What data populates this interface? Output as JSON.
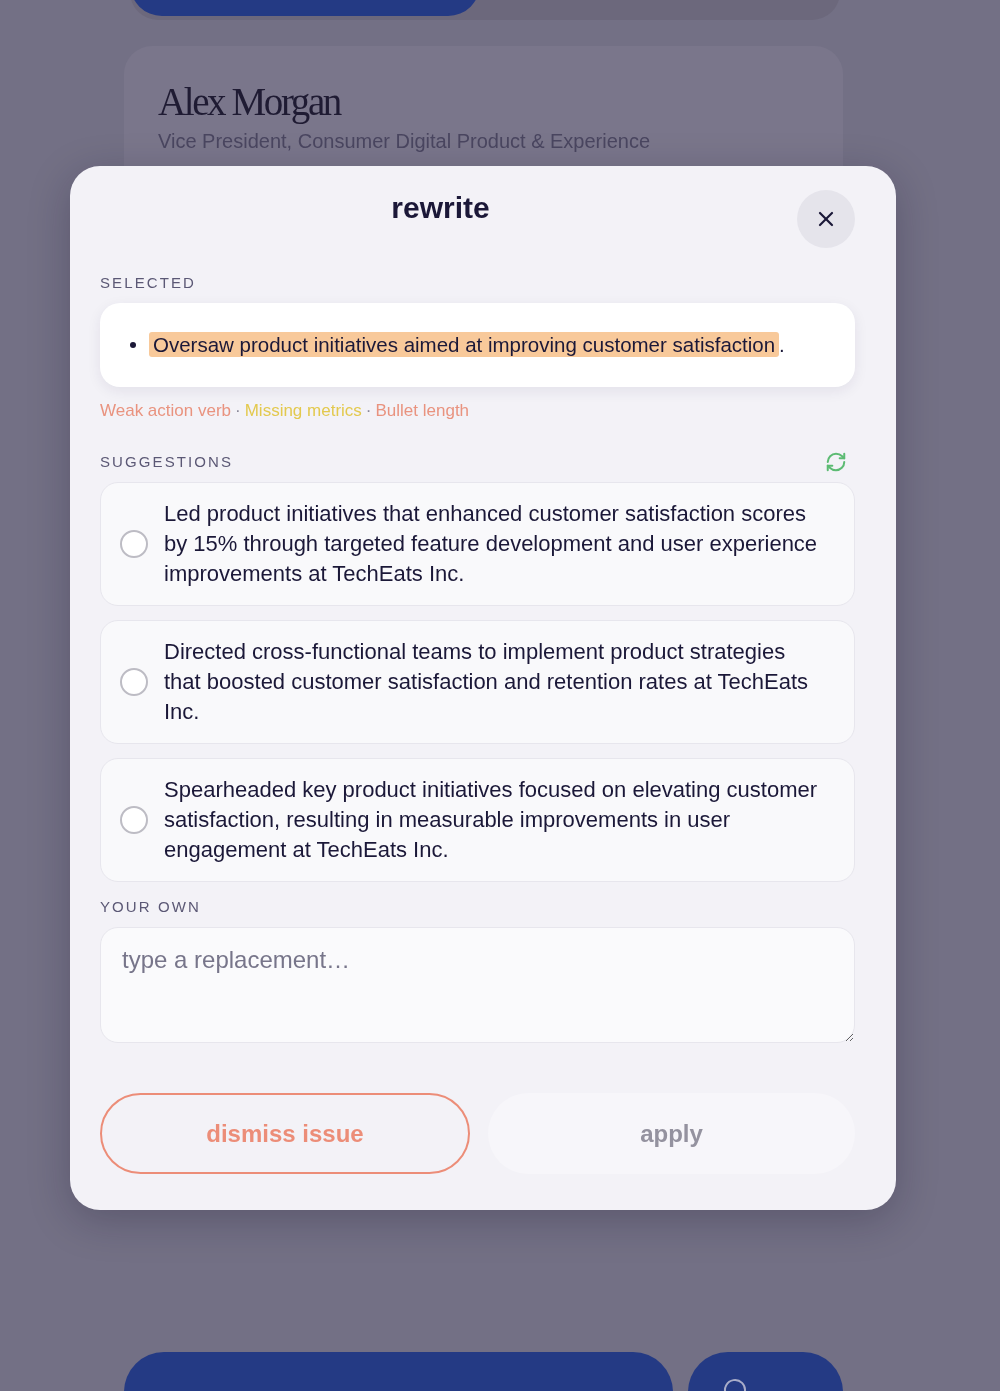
{
  "profile": {
    "name": "Alex Morgan",
    "title": "Vice President, Consumer Digital Product & Experience"
  },
  "dialog": {
    "title": "rewrite",
    "selected": {
      "label": "SELECTED",
      "text": "Oversaw product initiatives aimed at improving customer satisfaction",
      "highlighted": true,
      "trailing": "."
    },
    "issues": {
      "separator": "·",
      "items": [
        {
          "label": "Weak action verb",
          "color": "#e9937f"
        },
        {
          "label": "Missing metrics",
          "color": "#e3c94e"
        },
        {
          "label": "Bullet length",
          "color": "#e9937f"
        }
      ]
    },
    "suggestions": {
      "label": "SUGGESTIONS",
      "items": [
        {
          "text": "Led product initiatives that enhanced customer satisfaction scores by 15% through targeted feature development and user experience improvements at TechEats Inc.",
          "selected": false
        },
        {
          "text": "Directed cross-functional teams to implement product strategies that boosted customer satisfaction and retention rates at TechEats Inc.",
          "selected": false
        },
        {
          "text": "Spearheaded key product initiatives focused on elevating customer satisfaction, resulting in measurable improvements in user engagement at TechEats Inc.",
          "selected": false
        }
      ]
    },
    "your_own": {
      "label": "YOUR OWN",
      "placeholder": "type a replacement…"
    },
    "buttons": [
      {
        "kind": "outline",
        "label": "dismiss issue",
        "disabled": false
      },
      {
        "kind": "filled",
        "label": "apply",
        "disabled": true
      }
    ]
  },
  "bottom_actions": [
    {
      "kind": "primary"
    },
    {
      "kind": "chat"
    }
  ]
}
